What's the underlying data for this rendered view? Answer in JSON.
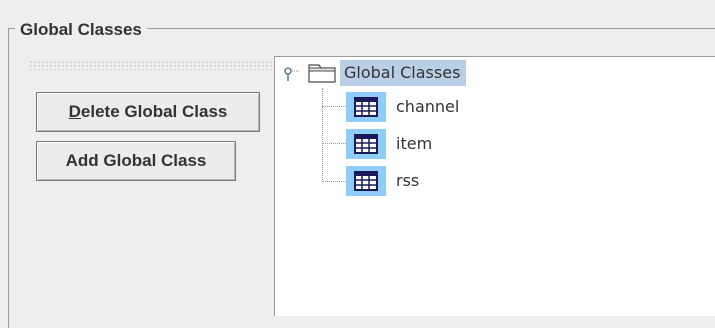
{
  "group": {
    "title": "Global Classes"
  },
  "buttons": {
    "delete_mnemonic": "D",
    "delete_rest": "elete Global Class",
    "add": "Add Global Class"
  },
  "tree": {
    "root": {
      "label": "Global Classes",
      "icon": "folder-icon",
      "selected": true
    },
    "children": [
      {
        "label": "channel",
        "icon": "table-icon"
      },
      {
        "label": "item",
        "icon": "table-icon"
      },
      {
        "label": "rss",
        "icon": "table-icon"
      }
    ]
  },
  "colors": {
    "selection": "#b8cfe5",
    "icon_highlight": "#8fcdf7",
    "background": "#eeeeee"
  }
}
